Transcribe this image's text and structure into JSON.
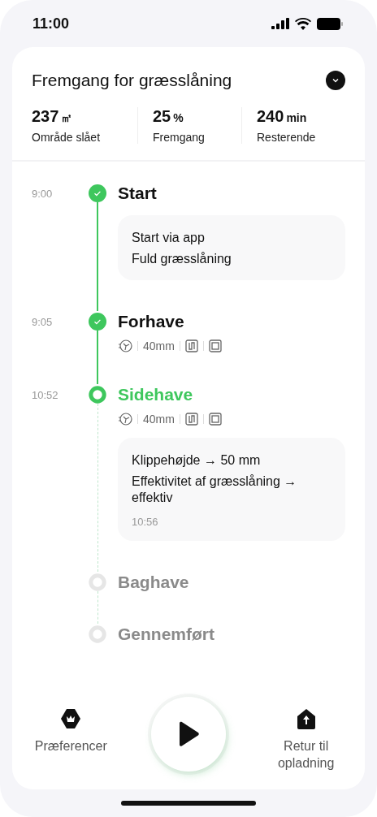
{
  "status_bar": {
    "time": "11:00"
  },
  "header": {
    "title": "Fremgang for græsslåning",
    "expanded": false
  },
  "stats": [
    {
      "value": "237",
      "unit": "㎡",
      "label": "Område slået"
    },
    {
      "value": "25",
      "unit": "%",
      "label": "Fremgang"
    },
    {
      "value": "240",
      "unit": "min",
      "label": "Resterende"
    }
  ],
  "steps": [
    {
      "time": "9:00",
      "title": "Start",
      "done": true,
      "current": false,
      "note": {
        "lines": [
          "Start via app",
          "Fuld græsslåning"
        ]
      }
    },
    {
      "time": "9:05",
      "title": "Forhave",
      "done": true,
      "current": false,
      "height": "40mm"
    },
    {
      "time": "10:52",
      "title": "Sidehave",
      "done": false,
      "current": true,
      "height": "40mm",
      "note": {
        "lines": [
          "Klippehøjde → 50 mm",
          "Effektivitet af græsslåning → effektiv"
        ],
        "time": "10:56"
      }
    },
    {
      "title": "Baghave",
      "done": false,
      "current": false
    },
    {
      "title": "Gennemført",
      "done": false,
      "current": false
    }
  ],
  "nav": [
    {
      "kind": "preferences",
      "label": "Præferencer"
    },
    {
      "kind": "play"
    },
    {
      "kind": "dock",
      "label": "Retur til opladning"
    }
  ]
}
